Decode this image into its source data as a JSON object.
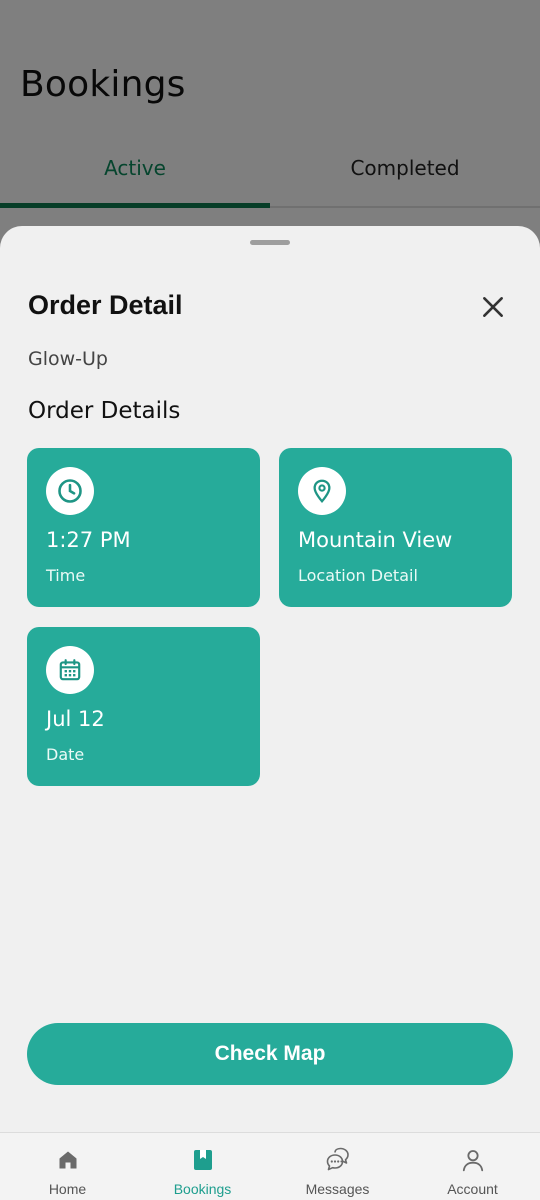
{
  "background": {
    "title": "Bookings",
    "tabs": [
      {
        "label": "Active",
        "active": true
      },
      {
        "label": "Completed",
        "active": false
      }
    ]
  },
  "sheet": {
    "title": "Order Detail",
    "subtitle": "Glow-Up",
    "section_title": "Order Details",
    "cards": [
      {
        "value": "1:27 PM",
        "label": "Time",
        "icon": "clock-icon"
      },
      {
        "value": "Mountain View",
        "label": "Location Detail",
        "icon": "location-pin-icon"
      },
      {
        "value": "Jul 12",
        "label": "Date",
        "icon": "calendar-icon"
      }
    ],
    "cta_label": "Check Map",
    "close_icon": "close-icon"
  },
  "nav": {
    "items": [
      {
        "label": "Home",
        "icon": "home-icon",
        "active": false
      },
      {
        "label": "Bookings",
        "icon": "bookmark-icon",
        "active": true
      },
      {
        "label": "Messages",
        "icon": "chat-icon",
        "active": false
      },
      {
        "label": "Account",
        "icon": "person-icon",
        "active": false
      }
    ]
  },
  "colors": {
    "accent": "#26ab9a",
    "active_tab_text": "#0d8a5c",
    "active_tab_indicator": "#0d7a4f",
    "sheet_background": "#f0f0f0"
  }
}
